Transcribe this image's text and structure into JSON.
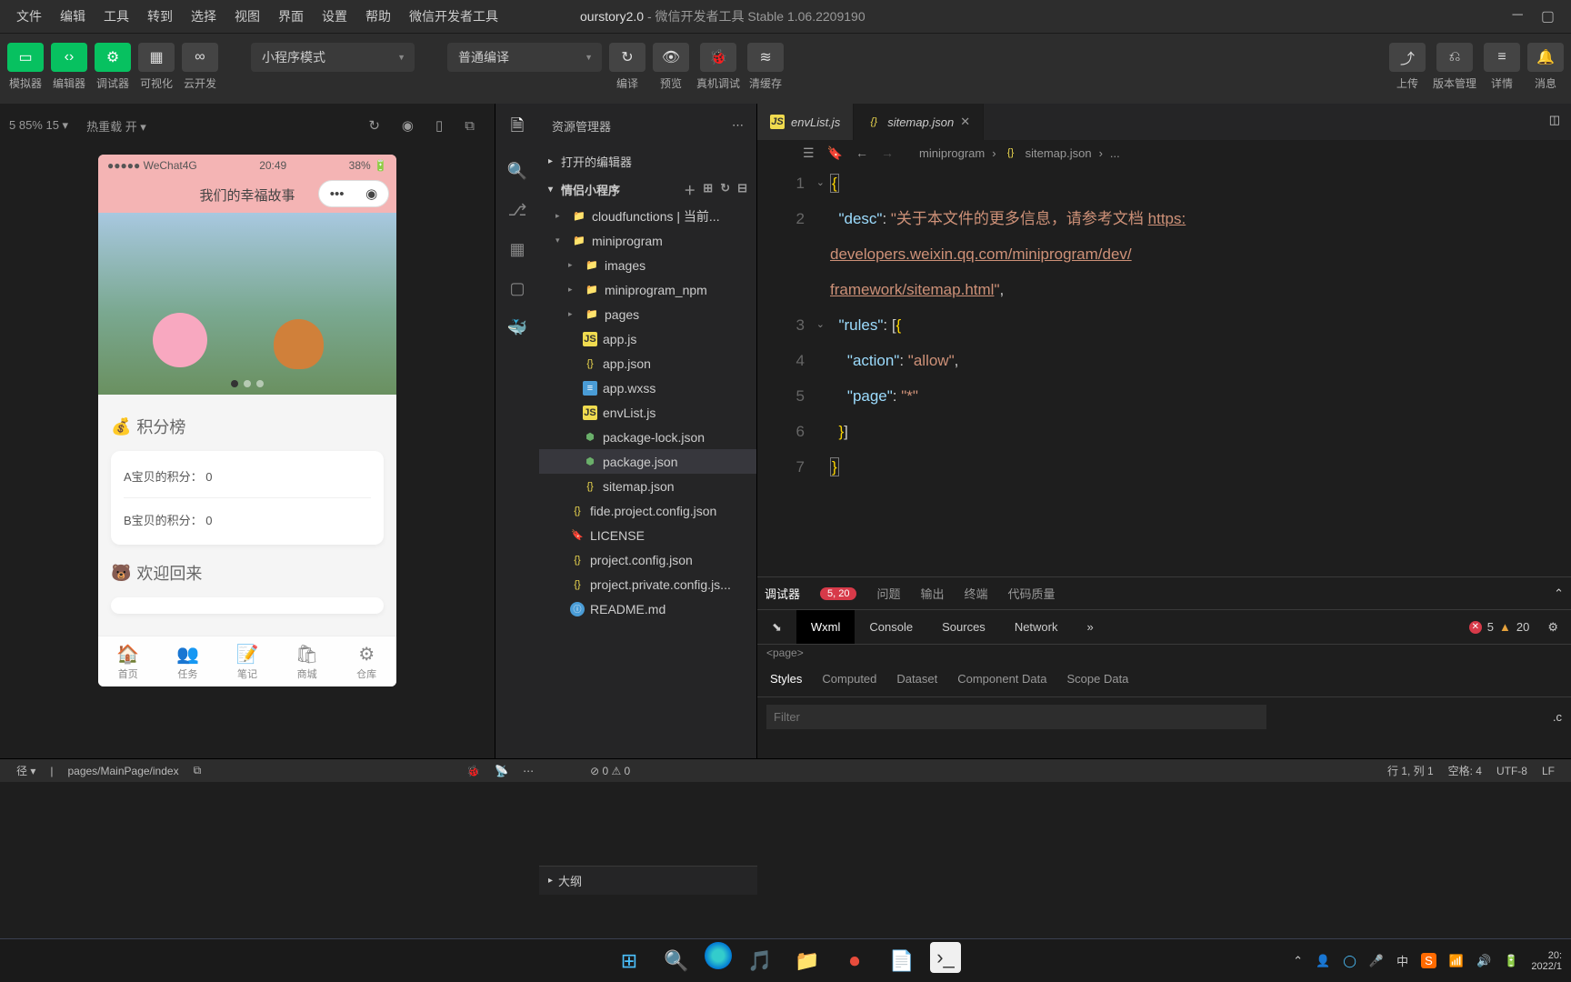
{
  "titlebar": {
    "menus": [
      "文件",
      "编辑",
      "工具",
      "转到",
      "选择",
      "视图",
      "界面",
      "设置",
      "帮助",
      "微信开发者工具"
    ],
    "project": "ourstory2.0",
    "subtitle": "- 微信开发者工具 Stable 1.06.2209190"
  },
  "toolbar": {
    "buttons": [
      {
        "icon": "▭",
        "label": "模拟器",
        "green": true
      },
      {
        "icon": "‹›",
        "label": "编辑器",
        "green": true
      },
      {
        "icon": "⚙",
        "label": "调试器",
        "green": true
      },
      {
        "icon": "▦",
        "label": "可视化",
        "green": false
      },
      {
        "icon": "∞",
        "label": "云开发",
        "green": false
      }
    ],
    "mode": "小程序模式",
    "compile": "普通编译",
    "mid": [
      {
        "icon": "↻",
        "label": "编译"
      },
      {
        "icon": "👁",
        "label": "预览"
      },
      {
        "icon": "🐞",
        "label": "真机调试"
      },
      {
        "icon": "≋",
        "label": "清缓存"
      }
    ],
    "right": [
      {
        "icon": "⤴",
        "label": "上传"
      },
      {
        "icon": "⎌",
        "label": "版本管理"
      },
      {
        "icon": "≡",
        "label": "详情"
      },
      {
        "icon": "🔔",
        "label": "消息"
      }
    ]
  },
  "simulator": {
    "zoom": "5 85% 15 ▾",
    "hot": "热重载 开 ▾",
    "status": {
      "sig": "●●●●●",
      "carrier": "WeChat4G",
      "time": "20:49",
      "bat": "38%"
    },
    "title": "我们的幸福故事",
    "sec1": {
      "icon": "💰",
      "title": "积分榜"
    },
    "rows": [
      "A宝贝的积分： 0",
      "B宝贝的积分： 0"
    ],
    "sec2": {
      "icon": "🐻",
      "title": "欢迎回来"
    },
    "tabs": [
      {
        "icon": "🏠",
        "label": "首页"
      },
      {
        "icon": "👥",
        "label": "任务"
      },
      {
        "icon": "📝",
        "label": "笔记"
      },
      {
        "icon": "🛍",
        "label": "商城"
      },
      {
        "icon": "⚙",
        "label": "仓库"
      }
    ]
  },
  "explorer": {
    "title": "资源管理器",
    "open_editors": "打开的编辑器",
    "project": "情侣小程序",
    "outline": "大纲",
    "tree": [
      {
        "t": "d",
        "d": 0,
        "icon": "folder",
        "name": "cloudfunctions | 当前...",
        "chev": "▸"
      },
      {
        "t": "d",
        "d": 0,
        "icon": "folder-g",
        "name": "miniprogram",
        "chev": "▾"
      },
      {
        "t": "d",
        "d": 1,
        "icon": "folder-b",
        "name": "images",
        "chev": "▸"
      },
      {
        "t": "d",
        "d": 1,
        "icon": "folder",
        "name": "miniprogram_npm",
        "chev": "▸"
      },
      {
        "t": "d",
        "d": 1,
        "icon": "folder",
        "name": "pages",
        "chev": "▸"
      },
      {
        "t": "f",
        "d": 1,
        "icon": "js",
        "name": "app.js"
      },
      {
        "t": "f",
        "d": 1,
        "icon": "json",
        "name": "app.json"
      },
      {
        "t": "f",
        "d": 1,
        "icon": "wxss",
        "name": "app.wxss"
      },
      {
        "t": "f",
        "d": 1,
        "icon": "js",
        "name": "envList.js"
      },
      {
        "t": "f",
        "d": 1,
        "icon": "npm",
        "name": "package-lock.json"
      },
      {
        "t": "f",
        "d": 1,
        "icon": "npm",
        "name": "package.json",
        "sel": true
      },
      {
        "t": "f",
        "d": 1,
        "icon": "json",
        "name": "sitemap.json"
      },
      {
        "t": "f",
        "d": 0,
        "icon": "json",
        "name": "fide.project.config.json"
      },
      {
        "t": "f",
        "d": 0,
        "icon": "lic",
        "name": "LICENSE"
      },
      {
        "t": "f",
        "d": 0,
        "icon": "json",
        "name": "project.config.json"
      },
      {
        "t": "f",
        "d": 0,
        "icon": "json",
        "name": "project.private.config.js..."
      },
      {
        "t": "f",
        "d": 0,
        "icon": "md",
        "name": "README.md"
      }
    ]
  },
  "editor": {
    "tabs": [
      {
        "icon": "js",
        "name": "envList.js",
        "active": false
      },
      {
        "icon": "json",
        "name": "sitemap.json",
        "active": true
      }
    ],
    "crumb": [
      "miniprogram",
      "sitemap.json",
      "..."
    ],
    "code_strings": {
      "desc_key": "\"desc\"",
      "desc_pre": "\"关于本文件的更多信息，请参考文档 ",
      "link1": "https:",
      "link2": "developers.weixin.qq.com/miniprogram/dev/",
      "link3": "framework/sitemap.html",
      "rules_key": "\"rules\"",
      "action_key": "\"action\"",
      "action_val": "\"allow\"",
      "page_key": "\"page\"",
      "page_val": "\"*\""
    }
  },
  "devtools": {
    "tabs": [
      "调试器",
      "问题",
      "输出",
      "终端",
      "代码质量"
    ],
    "badge": "5, 20",
    "sub": [
      "Wxml",
      "Console",
      "Sources",
      "Network"
    ],
    "err": "5",
    "warn": "20",
    "page_tag": "<page>",
    "styles": [
      "Styles",
      "Computed",
      "Dataset",
      "Component Data",
      "Scope Data"
    ],
    "filter": "Filter",
    "cls": ".c"
  },
  "statusbar": {
    "left_path": "pages/MainPage/index",
    "left_pre": "径 ▾",
    "problems": "⊘ 0 ⚠ 0",
    "pos": "行 1, 列 1",
    "spaces": "空格: 4",
    "enc": "UTF-8",
    "eol": "LF"
  },
  "taskbar": {
    "time1": "20:",
    "time2": "2022/1"
  }
}
